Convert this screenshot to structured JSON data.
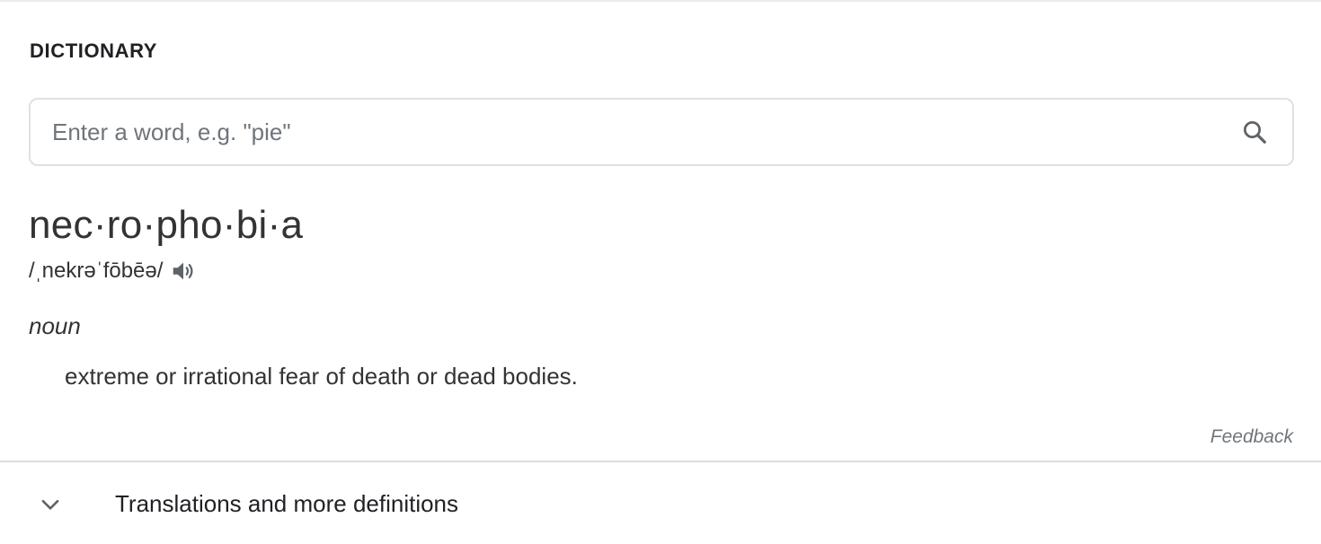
{
  "dictionary": {
    "section_title": "DICTIONARY",
    "search": {
      "placeholder": "Enter a word, e.g. \"pie\"",
      "value": "",
      "icon": "search-icon"
    },
    "entry": {
      "headword": "nec·ro·pho·bi·a",
      "pronunciation": "/ˌnekrəˈfōbēə/",
      "audio_icon": "speaker-icon",
      "part_of_speech": "noun",
      "definition": "extreme or irrational fear of death or dead bodies."
    },
    "feedback_label": "Feedback",
    "more": {
      "label": "Translations and more definitions",
      "icon": "chevron-down-icon"
    }
  },
  "colors": {
    "text": "#333333",
    "muted": "#70757a",
    "border": "#dfe1e5",
    "icon": "#5f6368"
  }
}
